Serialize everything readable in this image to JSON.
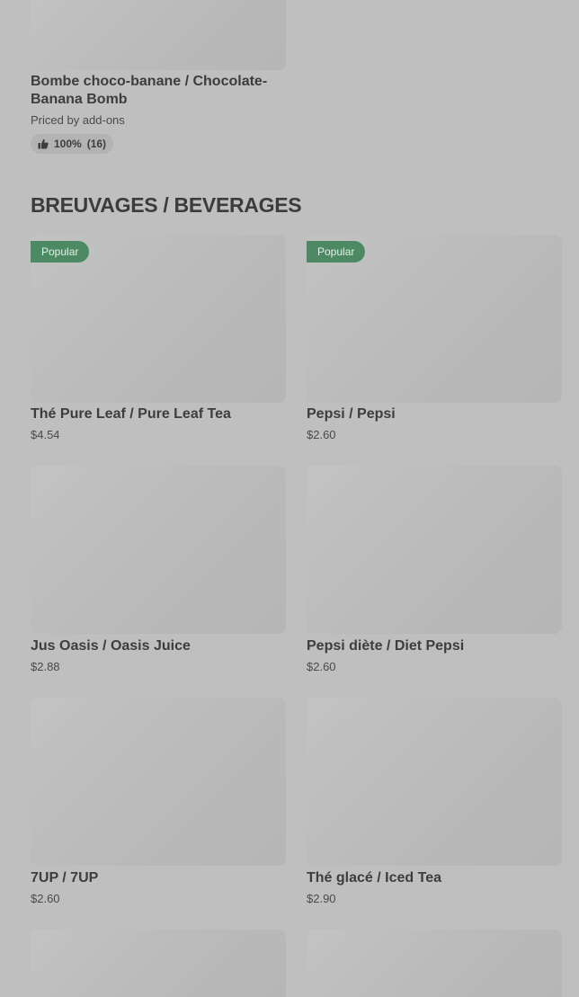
{
  "dessert_item": {
    "title": "Bombe choco-banane / Chocolate-Banana Bomb",
    "price": "Priced by add-ons",
    "rating": {
      "percent": "100%",
      "count": "(16)",
      "icon": "thumbs-up-icon"
    }
  },
  "section": {
    "heading": "BREUVAGES / BEVERAGES"
  },
  "beverages": [
    {
      "title": "Thé Pure Leaf  / Pure Leaf Tea",
      "price": "$4.54",
      "badge": "Popular"
    },
    {
      "title": "Pepsi  / Pepsi",
      "price": "$2.60",
      "badge": "Popular"
    },
    {
      "title": "Jus Oasis / Oasis Juice",
      "price": "$2.88",
      "badge": ""
    },
    {
      "title": "Pepsi diète / Diet Pepsi",
      "price": "$2.60",
      "badge": ""
    },
    {
      "title": "7UP / 7UP",
      "price": "$2.60",
      "badge": ""
    },
    {
      "title": "Thé glacé  / Iced Tea",
      "price": "$2.90",
      "badge": ""
    }
  ],
  "colors": {
    "overlay_background": "#bfbfbf",
    "badge_green": "#4d8a64",
    "text_dark": "#3d3d3d"
  }
}
